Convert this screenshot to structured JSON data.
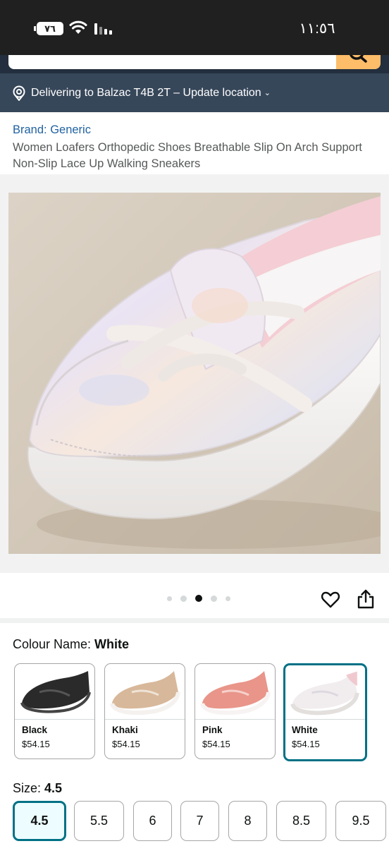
{
  "status_bar": {
    "time": "١١:٥٦",
    "battery": "٧٦",
    "icons": [
      "battery-icon",
      "wifi-icon",
      "signal-icon"
    ]
  },
  "search": {
    "icons": [
      "search-icon"
    ],
    "accent_color": "#febd69"
  },
  "delivery": {
    "text": "Delivering to Balzac T4B 2T – Update location",
    "icons": [
      "location-pin-icon",
      "chevron-down-icon"
    ],
    "background": "#37475a"
  },
  "product": {
    "brand_link": "Brand: Generic",
    "title": "Women Loafers Orthopedic Shoes Breathable Slip On Arch Support Non-Slip Lace Up Walking Sneakers"
  },
  "gallery": {
    "image": "iridescent-white-slip-on-sneaker",
    "dot_count": 5,
    "active_dot": 3,
    "actions": [
      "heart-icon",
      "share-icon"
    ]
  },
  "colour": {
    "label": "Colour Name: ",
    "selected": "White",
    "options": [
      {
        "name": "Black",
        "price": "$54.15",
        "color": "#2a2a2a"
      },
      {
        "name": "Khaki",
        "price": "$54.15",
        "color": "#d8b89a"
      },
      {
        "name": "Pink",
        "price": "$54.15",
        "color": "#e9958a"
      },
      {
        "name": "White",
        "price": "$54.15",
        "color": "#f1ecee"
      }
    ]
  },
  "size": {
    "label": "Size: ",
    "selected": "4.5",
    "options": [
      "4.5",
      "5.5",
      "6",
      "7",
      "8",
      "8.5",
      "9.5"
    ]
  },
  "colors": {
    "link": "#2162a1",
    "selected_border": "#007185",
    "selected_fill": "#edfdff"
  }
}
